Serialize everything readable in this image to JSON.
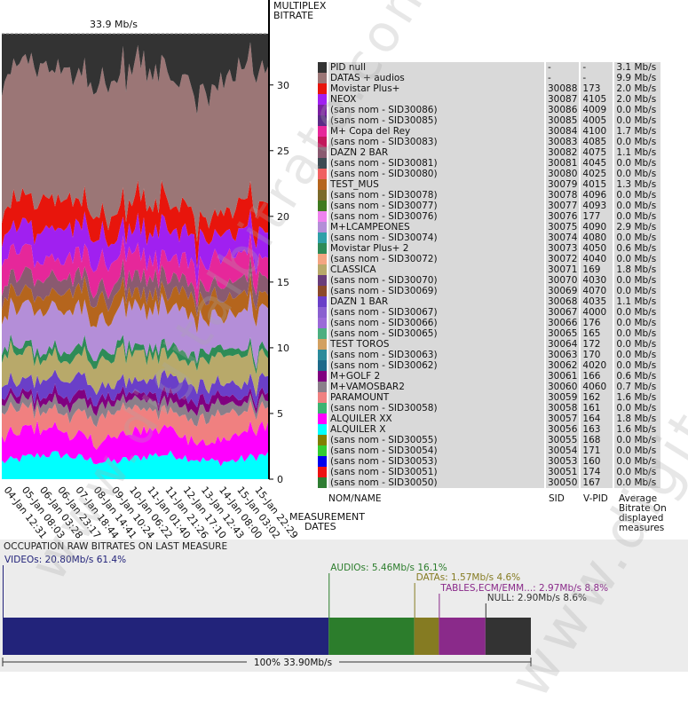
{
  "chart_data": [
    {
      "type": "area",
      "title": "MULTIPLEX BITRATE",
      "total_label": "33.9 Mb/s",
      "ylim": [
        0,
        33.9
      ],
      "yticks": [
        "0",
        "5",
        "10",
        "15",
        "20",
        "25",
        "30"
      ],
      "xlabel": "MEASUREMENT DATES",
      "x_tick_labels": [
        "04-Jan 12:31",
        "05-Jan 08:03",
        "06-Jan 03:28",
        "06-Jan 23:17",
        "07-Jan 18:44",
        "08-Jan 14:41",
        "09-Jan 10:24",
        "10-Jan 06:22",
        "11-Jan 01:40",
        "11-Jan 21:26",
        "12-Jan 17:10",
        "13-Jan 12:43",
        "14-Jan 08:00",
        "15-Jan 03:02",
        "15-Jan 22:29"
      ],
      "legend_headers": {
        "name": "NOM/NAME",
        "sid": "SID",
        "vpid": "V-PID",
        "bitrate": "Average Bitrate On displayed measures"
      },
      "series": [
        {
          "name": "PID null",
          "sid": "-",
          "vpid": "-",
          "bitrate": "3.1 Mb/s",
          "value": 3.1,
          "color": "#333333"
        },
        {
          "name": "DATAS + audios",
          "sid": "-",
          "vpid": "-",
          "bitrate": "9.9 Mb/s",
          "value": 9.9,
          "color": "#9b7676"
        },
        {
          "name": "Movistar Plus+",
          "sid": "30088",
          "vpid": "173",
          "bitrate": "2.0 Mb/s",
          "value": 2.0,
          "color": "#e8150c"
        },
        {
          "name": "NEOX",
          "sid": "30087",
          "vpid": "4105",
          "bitrate": "2.0 Mb/s",
          "value": 2.0,
          "color": "#a020f0"
        },
        {
          "name": "(sans nom - SID30086)",
          "sid": "30086",
          "vpid": "4009",
          "bitrate": "0.0 Mb/s",
          "value": 0.0,
          "color": "#7b1fa2"
        },
        {
          "name": "(sans nom - SID30085)",
          "sid": "30085",
          "vpid": "4005",
          "bitrate": "0.0 Mb/s",
          "value": 0.0,
          "color": "#5a2a86"
        },
        {
          "name": "M+ Copa del Rey",
          "sid": "30084",
          "vpid": "4100",
          "bitrate": "1.7 Mb/s",
          "value": 1.7,
          "color": "#e6279a"
        },
        {
          "name": "(sans nom - SID30083)",
          "sid": "30083",
          "vpid": "4085",
          "bitrate": "0.0 Mb/s",
          "value": 0.0,
          "color": "#c2185b"
        },
        {
          "name": "DAZN 2 BAR",
          "sid": "30082",
          "vpid": "4075",
          "bitrate": "1.1 Mb/s",
          "value": 1.1,
          "color": "#8a5a70"
        },
        {
          "name": "(sans nom - SID30081)",
          "sid": "30081",
          "vpid": "4045",
          "bitrate": "0.0 Mb/s",
          "value": 0.0,
          "color": "#3c4a52"
        },
        {
          "name": "(sans nom - SID30080)",
          "sid": "30080",
          "vpid": "4025",
          "bitrate": "0.0 Mb/s",
          "value": 0.0,
          "color": "#f06060"
        },
        {
          "name": "TEST_MUS",
          "sid": "30079",
          "vpid": "4015",
          "bitrate": "1.3 Mb/s",
          "value": 1.3,
          "color": "#b5651d"
        },
        {
          "name": "(sans nom - SID30078)",
          "sid": "30078",
          "vpid": "4096",
          "bitrate": "0.0 Mb/s",
          "value": 0.0,
          "color": "#7a6a2a"
        },
        {
          "name": "(sans nom - SID30077)",
          "sid": "30077",
          "vpid": "4093",
          "bitrate": "0.0 Mb/s",
          "value": 0.0,
          "color": "#3f7a1f"
        },
        {
          "name": "(sans nom - SID30076)",
          "sid": "30076",
          "vpid": "177",
          "bitrate": "0.0 Mb/s",
          "value": 0.0,
          "color": "#ee82ee"
        },
        {
          "name": "M+LCAMPEONES",
          "sid": "30075",
          "vpid": "4090",
          "bitrate": "2.9 Mb/s",
          "value": 2.9,
          "color": "#b48ed8"
        },
        {
          "name": "(sans nom - SID30074)",
          "sid": "30074",
          "vpid": "4080",
          "bitrate": "0.0 Mb/s",
          "value": 0.0,
          "color": "#30a0a8"
        },
        {
          "name": "Movistar Plus+ 2",
          "sid": "30073",
          "vpid": "4050",
          "bitrate": "0.6 Mb/s",
          "value": 0.6,
          "color": "#2e8b57"
        },
        {
          "name": "(sans nom - SID30072)",
          "sid": "30072",
          "vpid": "4040",
          "bitrate": "0.0 Mb/s",
          "value": 0.0,
          "color": "#f4a582"
        },
        {
          "name": "CLASSICA",
          "sid": "30071",
          "vpid": "169",
          "bitrate": "1.8 Mb/s",
          "value": 1.8,
          "color": "#b8a96a"
        },
        {
          "name": "(sans nom - SID30070)",
          "sid": "30070",
          "vpid": "4030",
          "bitrate": "0.0 Mb/s",
          "value": 0.0,
          "color": "#6a3d7a"
        },
        {
          "name": "(sans nom - SID30069)",
          "sid": "30069",
          "vpid": "4070",
          "bitrate": "0.0 Mb/s",
          "value": 0.0,
          "color": "#8c4a2a"
        },
        {
          "name": "DAZN 1 BAR",
          "sid": "30068",
          "vpid": "4035",
          "bitrate": "1.1 Mb/s",
          "value": 1.1,
          "color": "#6a3fc8"
        },
        {
          "name": "(sans nom - SID30067)",
          "sid": "30067",
          "vpid": "4000",
          "bitrate": "0.0 Mb/s",
          "value": 0.0,
          "color": "#8a60d0"
        },
        {
          "name": "(sans nom - SID30066)",
          "sid": "30066",
          "vpid": "176",
          "bitrate": "0.0 Mb/s",
          "value": 0.0,
          "color": "#9b6ad8"
        },
        {
          "name": "(sans nom - SID30065)",
          "sid": "30065",
          "vpid": "165",
          "bitrate": "0.0 Mb/s",
          "value": 0.0,
          "color": "#4caf80"
        },
        {
          "name": "TEST TOROS",
          "sid": "30064",
          "vpid": "172",
          "bitrate": "0.0 Mb/s",
          "value": 0.0,
          "color": "#d2a060"
        },
        {
          "name": "(sans nom - SID30063)",
          "sid": "30063",
          "vpid": "170",
          "bitrate": "0.0 Mb/s",
          "value": 0.0,
          "color": "#2a8a9a"
        },
        {
          "name": "(sans nom - SID30062)",
          "sid": "30062",
          "vpid": "4020",
          "bitrate": "0.0 Mb/s",
          "value": 0.0,
          "color": "#1e6a8a"
        },
        {
          "name": "M+GOLF 2",
          "sid": "30061",
          "vpid": "166",
          "bitrate": "0.6 Mb/s",
          "value": 0.6,
          "color": "#800080"
        },
        {
          "name": "M+VAMOSBAR2",
          "sid": "30060",
          "vpid": "4060",
          "bitrate": "0.7 Mb/s",
          "value": 0.7,
          "color": "#8a7f8a"
        },
        {
          "name": "PARAMOUNT",
          "sid": "30059",
          "vpid": "162",
          "bitrate": "1.6 Mb/s",
          "value": 1.6,
          "color": "#f08080"
        },
        {
          "name": "(sans nom - SID30058)",
          "sid": "30058",
          "vpid": "161",
          "bitrate": "0.0 Mb/s",
          "value": 0.0,
          "color": "#3cb371"
        },
        {
          "name": "ALQUILER XX",
          "sid": "30057",
          "vpid": "164",
          "bitrate": "1.8 Mb/s",
          "value": 1.8,
          "color": "#ff00ff"
        },
        {
          "name": "ALQUILER X",
          "sid": "30056",
          "vpid": "163",
          "bitrate": "1.6 Mb/s",
          "value": 1.6,
          "color": "#00ffff"
        },
        {
          "name": "(sans nom - SID30055)",
          "sid": "30055",
          "vpid": "168",
          "bitrate": "0.0 Mb/s",
          "value": 0.0,
          "color": "#808000"
        },
        {
          "name": "(sans nom - SID30054)",
          "sid": "30054",
          "vpid": "171",
          "bitrate": "0.0 Mb/s",
          "value": 0.0,
          "color": "#32cd32"
        },
        {
          "name": "(sans nom - SID30053)",
          "sid": "30053",
          "vpid": "160",
          "bitrate": "0.0 Mb/s",
          "value": 0.0,
          "color": "#0000ee"
        },
        {
          "name": "(sans nom - SID30051)",
          "sid": "30051",
          "vpid": "174",
          "bitrate": "0.0 Mb/s",
          "value": 0.0,
          "color": "#ee1111"
        },
        {
          "name": "(sans nom - SID30050)",
          "sid": "30050",
          "vpid": "167",
          "bitrate": "0.0 Mb/s",
          "value": 0.0,
          "color": "#2e7d32"
        }
      ]
    },
    {
      "type": "bar",
      "title": "OCCUPATION RAW BITRATES ON LAST MEASURE",
      "total_label": "100%  33.90Mb/s",
      "segments": [
        {
          "label": "VIDEOs: 20.80Mb/s  61.4%",
          "value": 20.8,
          "percent": 61.4,
          "color": "#22237a"
        },
        {
          "label": "AUDIOs: 5.46Mb/s  16.1%",
          "value": 5.46,
          "percent": 16.1,
          "color": "#2c7d2c"
        },
        {
          "label": "DATAs: 1.57Mb/s  4.6%",
          "value": 1.57,
          "percent": 4.6,
          "color": "#857b22"
        },
        {
          "label": "TABLES,ECM/EMM...: 2.97Mb/s  8.8%",
          "value": 2.97,
          "percent": 8.8,
          "color": "#8a2a8a"
        },
        {
          "label": "NULL: 2.90Mb/s  8.6%",
          "value": 2.9,
          "percent": 8.6,
          "color": "#333333"
        }
      ]
    }
  ],
  "watermark": "www.digitalbitrate.com"
}
